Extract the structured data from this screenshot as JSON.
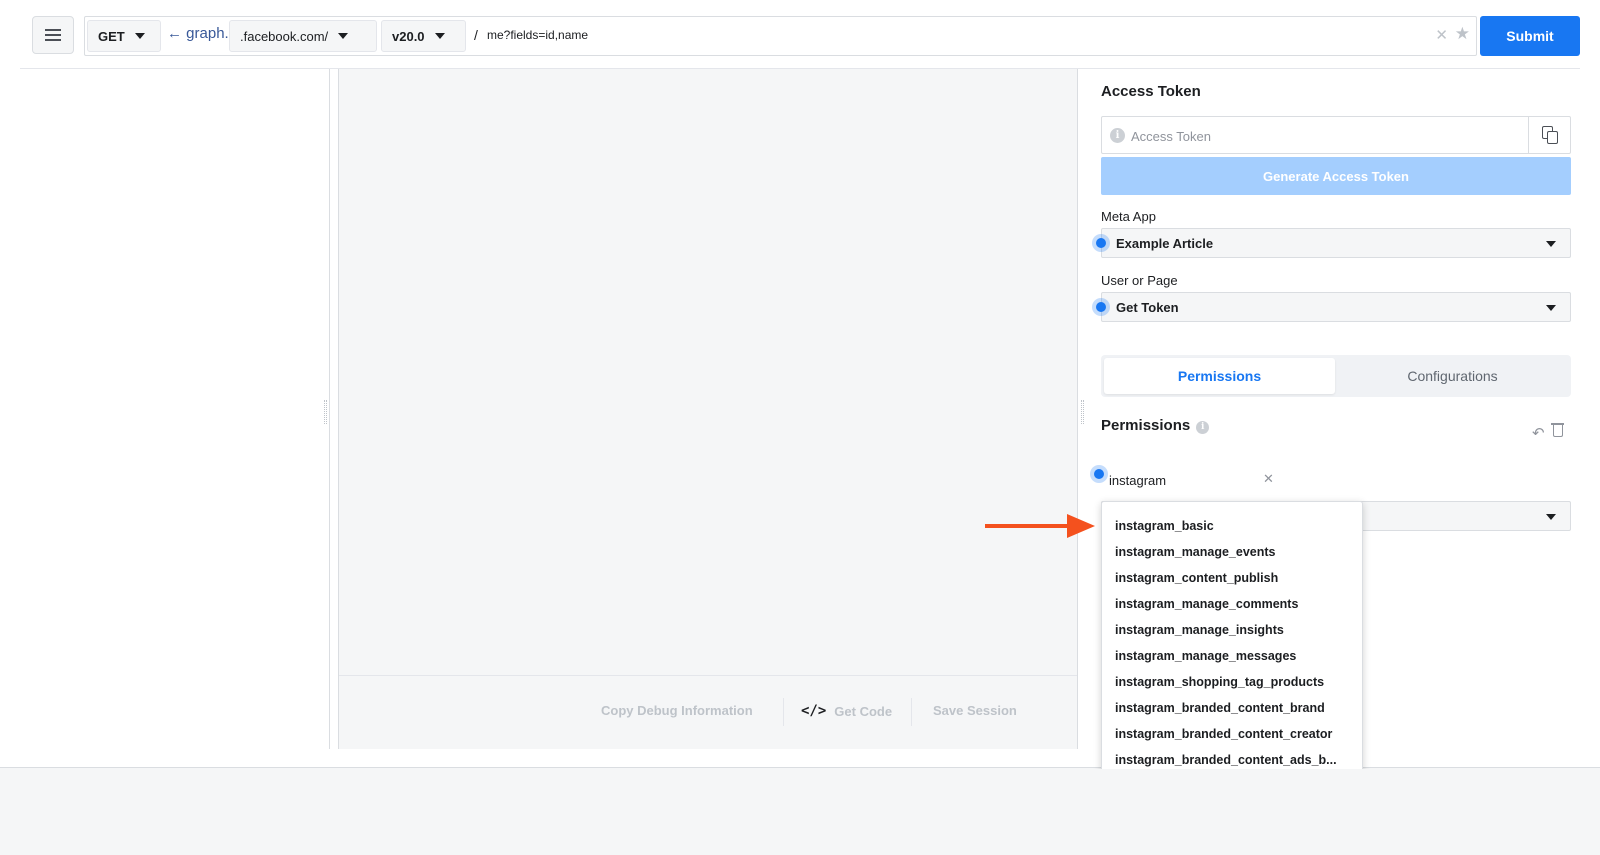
{
  "toolbar": {
    "method": "GET",
    "back_link": "← graph.",
    "domain": ".facebook.com/",
    "version": "v20.0",
    "path_separator": "/",
    "query": "me?fields=id,name",
    "submit_label": "Submit"
  },
  "footer_actions": {
    "copy_debug": "Copy Debug Information",
    "get_code": "Get Code",
    "get_code_icon": "</>",
    "save_session": "Save Session"
  },
  "access_token": {
    "title": "Access Token",
    "placeholder": "Access Token",
    "generate_label": "Generate Access Token"
  },
  "meta_app": {
    "label": "Meta App",
    "value": "Example Article"
  },
  "user_or_page": {
    "label": "User or Page",
    "value": "Get Token"
  },
  "tabs": {
    "active": "Permissions",
    "inactive": "Configurations"
  },
  "permissions": {
    "title": "Permissions",
    "search_value": "instagram",
    "options": [
      "instagram_basic",
      "instagram_manage_events",
      "instagram_content_publish",
      "instagram_manage_comments",
      "instagram_manage_insights",
      "instagram_manage_messages",
      "instagram_shopping_tag_products",
      "instagram_branded_content_brand",
      "instagram_branded_content_creator",
      "instagram_branded_content_ads_b..."
    ]
  },
  "colors": {
    "accent": "#1877f2",
    "annotation_arrow": "#f4511e"
  }
}
